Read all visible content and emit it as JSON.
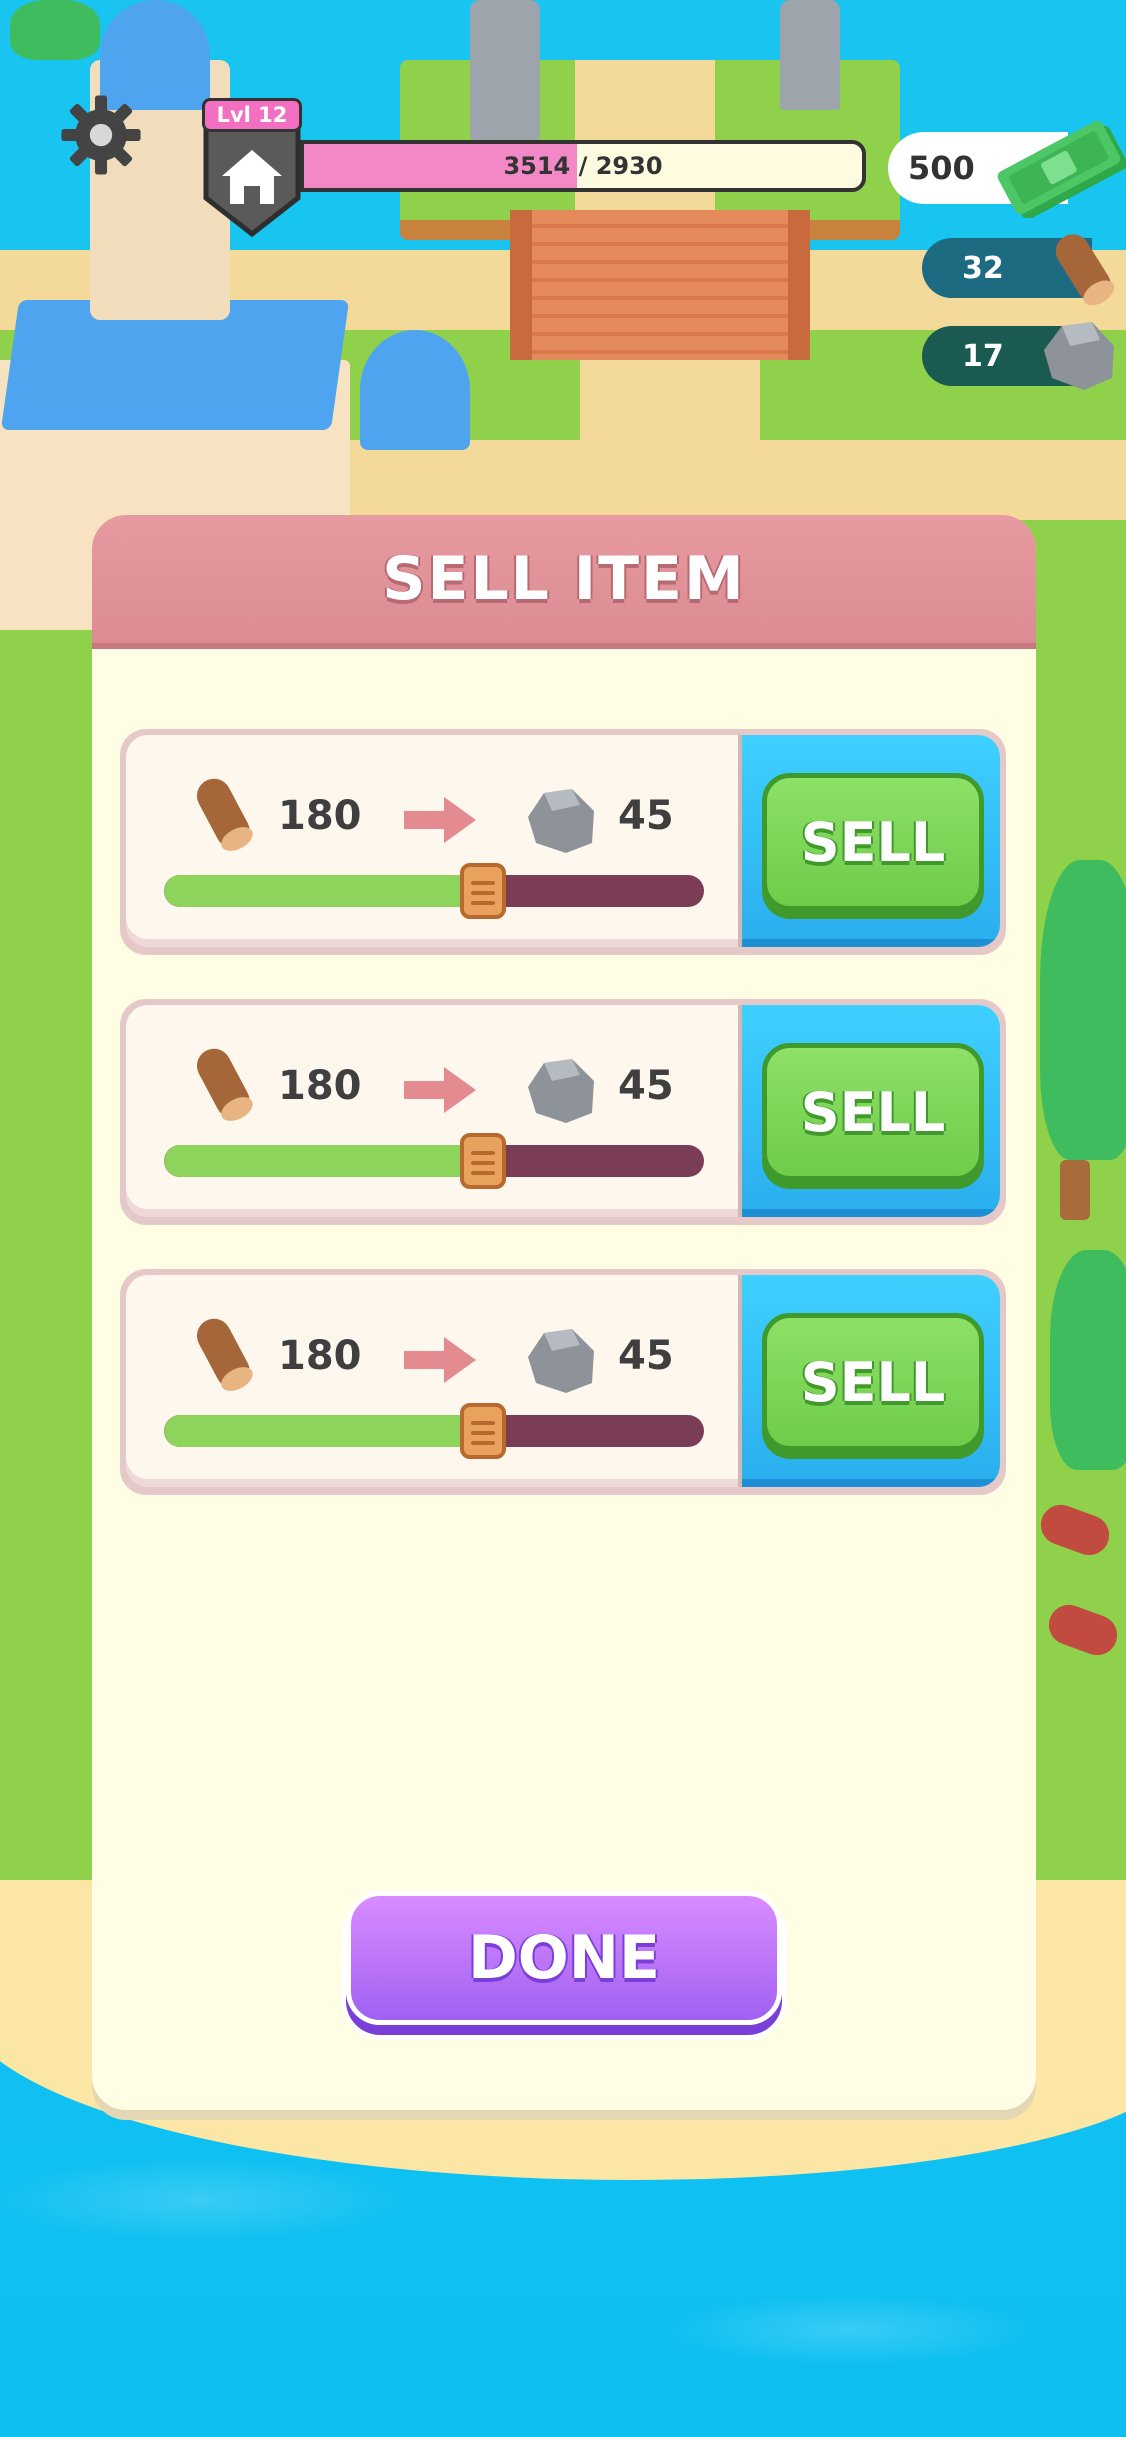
{
  "hud": {
    "level_label": "Lvl 12",
    "xp_text": "3514 / 2930",
    "xp_progress": 0.49,
    "cash": "500",
    "resources": [
      {
        "name": "wood",
        "icon": "wood-log-icon",
        "value": "32"
      },
      {
        "name": "stone",
        "icon": "stone-icon",
        "value": "17"
      }
    ]
  },
  "panel": {
    "title": "SELL ITEM",
    "offers": [
      {
        "give_icon": "wood-log-icon",
        "give_amount": "180",
        "get_icon": "stone-icon",
        "get_amount": "45",
        "slider_value": 0.59,
        "sell_label": "SELL"
      },
      {
        "give_icon": "wood-log-icon",
        "give_amount": "180",
        "get_icon": "stone-icon",
        "get_amount": "45",
        "slider_value": 0.59,
        "sell_label": "SELL"
      },
      {
        "give_icon": "wood-log-icon",
        "give_amount": "180",
        "get_icon": "stone-icon",
        "get_amount": "45",
        "slider_value": 0.59,
        "sell_label": "SELL"
      }
    ],
    "done_label": "DONE"
  },
  "colors": {
    "header": "#dc8b92",
    "panel_bg": "#fffde4",
    "sell_green": "#6fcc4a",
    "sell_bg_blue": "#2aaeee",
    "done_purple": "#a160f2",
    "xp_pink": "#f388c6",
    "slider_green": "#8ed35b",
    "slider_track": "#7a3d55"
  }
}
